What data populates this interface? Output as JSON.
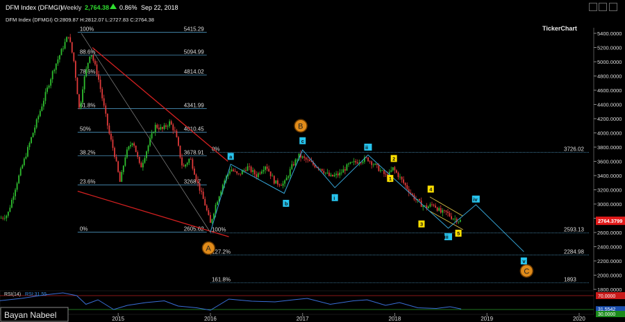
{
  "header": {
    "title": "DFM Index (DFMGI)",
    "interval": "Weekly",
    "last_price": "2,764.38",
    "up_arrow": "up-triangle",
    "change_pct": "0.86%",
    "date": "Sep 22, 2018",
    "ohlc_line": "DFM Index (DFMGI)   O:2809.87  H:2812.07  L:2727.83  C:2764.38"
  },
  "brand": {
    "logo": "TickerChart"
  },
  "watermark": "Bayan Nabeel",
  "colors": {
    "background": "#000000",
    "up_candle": "#2fbf2f",
    "down_candle": "#e03a3a",
    "fib_line": "#4a90b8",
    "trend_line": "#d42020",
    "wave_line": "#36a6d8",
    "label_yellow": "#ffe000",
    "label_cyan": "#27c4ee",
    "label_orange": "#e08b1a",
    "price_box": "#e21a1a"
  },
  "chart_data": {
    "type": "line",
    "price_axis": {
      "ticks": [
        {
          "v": 5400,
          "label": "5400.0000"
        },
        {
          "v": 5200,
          "label": "5200.0000"
        },
        {
          "v": 5000,
          "label": "5000.0000"
        },
        {
          "v": 4800,
          "label": "4800.0000"
        },
        {
          "v": 4600,
          "label": "4600.0000"
        },
        {
          "v": 4400,
          "label": "4400.0000"
        },
        {
          "v": 4200,
          "label": "4200.0000"
        },
        {
          "v": 4000,
          "label": "4000.0000"
        },
        {
          "v": 3800,
          "label": "3800.0000"
        },
        {
          "v": 3600,
          "label": "3600.0000"
        },
        {
          "v": 3400,
          "label": "3400.0000"
        },
        {
          "v": 3200,
          "label": "3200.0000"
        },
        {
          "v": 3000,
          "label": "3000.0000"
        },
        {
          "v": 2800,
          "label": "2800.0000"
        },
        {
          "v": 2600,
          "label": "2600.0000"
        },
        {
          "v": 2400,
          "label": "2400.0000"
        },
        {
          "v": 2200,
          "label": "2200.0000"
        },
        {
          "v": 2000,
          "label": "2000.0000"
        },
        {
          "v": 1800,
          "label": "1800.0000"
        }
      ],
      "last_price_label": "2764.3799",
      "last_price": 2764.38
    },
    "time_axis": {
      "ticks": [
        {
          "t": 2015.0,
          "label": "2015"
        },
        {
          "t": 2016.0,
          "label": "2016"
        },
        {
          "t": 2017.0,
          "label": "2017"
        },
        {
          "t": 2018.0,
          "label": "2018"
        },
        {
          "t": 2019.0,
          "label": "2019"
        },
        {
          "t": 2020.0,
          "label": "2020"
        }
      ]
    },
    "fib_retracement": {
      "from": 2014.56,
      "to": 2017.0,
      "levels": [
        {
          "pct": "100%",
          "price": 5415.29,
          "value": "5415.29"
        },
        {
          "pct": "88.6%",
          "price": 5094.99,
          "value": "5094.99"
        },
        {
          "pct": "78.6%",
          "price": 4814.02,
          "value": "4814.02"
        },
        {
          "pct": "61.8%",
          "price": 4341.99,
          "value": "4341.99"
        },
        {
          "pct": "50%",
          "price": 4010.45,
          "value": "4010.45"
        },
        {
          "pct": "38.2%",
          "price": 3678.91,
          "value": "3678.91"
        },
        {
          "pct": "23.6%",
          "price": 3268.7,
          "value": "3268.7"
        },
        {
          "pct": "0%",
          "price": 2605.62,
          "value": "2605.62"
        }
      ]
    },
    "fib_extension": {
      "from": 2016.0,
      "to": 2020.0,
      "levels": [
        {
          "pct": "0%",
          "price": 3726.02,
          "value": "3726.02"
        },
        {
          "pct": "100%",
          "price": 2593.13,
          "value": "2593.13"
        },
        {
          "pct": "127.2%",
          "price": 2284.98,
          "value": "2284.98"
        },
        {
          "pct": "161.8%",
          "price": 1893,
          "value": "1893"
        }
      ]
    },
    "trend_lines": [
      {
        "t1": 2014.72,
        "p1": 5200,
        "t2": 2016.19,
        "p2": 3600
      },
      {
        "t1": 2014.56,
        "p1": 3180,
        "t2": 2016.2,
        "p2": 2540
      },
      {
        "t1": 2014.6,
        "p1": 5400,
        "t2": 2016.0,
        "p2": 2600
      }
    ],
    "channel_lines": [
      {
        "t1": 2018.38,
        "p1": 3100,
        "t2": 2018.74,
        "p2": 2830
      },
      {
        "t1": 2018.38,
        "p1": 2900,
        "t2": 2018.74,
        "p2": 2640
      }
    ],
    "wave_path": [
      {
        "t": 2016.0,
        "p": 2605
      },
      {
        "t": 2016.22,
        "p": 3560
      },
      {
        "t": 2016.8,
        "p": 3150
      },
      {
        "t": 2017.0,
        "p": 3760
      },
      {
        "t": 2017.35,
        "p": 3230
      },
      {
        "t": 2017.71,
        "p": 3690
      },
      {
        "t": 2018.58,
        "p": 2660
      },
      {
        "t": 2018.88,
        "p": 2990
      },
      {
        "t": 2019.4,
        "p": 2330
      }
    ],
    "wave_labels": [
      {
        "text": "A",
        "t": 2015.98,
        "p": 2380,
        "style": "orange"
      },
      {
        "text": "B",
        "t": 2016.98,
        "p": 4100,
        "style": "orange"
      },
      {
        "text": "C",
        "t": 2019.43,
        "p": 2060,
        "style": "orange"
      },
      {
        "text": "a",
        "t": 2016.22,
        "p": 3670,
        "style": "cyan"
      },
      {
        "text": "b",
        "t": 2016.82,
        "p": 3010,
        "style": "cyan"
      },
      {
        "text": "c",
        "t": 2017.0,
        "p": 3890,
        "style": "cyan"
      },
      {
        "text": "i",
        "t": 2017.35,
        "p": 3090,
        "style": "cyan"
      },
      {
        "text": "ii",
        "t": 2017.71,
        "p": 3800,
        "style": "cyan"
      },
      {
        "text": "iii",
        "t": 2018.58,
        "p": 2540,
        "style": "cyan"
      },
      {
        "text": "iv",
        "t": 2018.88,
        "p": 3070,
        "style": "cyan"
      },
      {
        "text": "v",
        "t": 2019.4,
        "p": 2200,
        "style": "cyan"
      },
      {
        "text": "1",
        "t": 2017.95,
        "p": 3360,
        "style": "yellow"
      },
      {
        "text": "2",
        "t": 2017.99,
        "p": 3640,
        "style": "yellow"
      },
      {
        "text": "3",
        "t": 2018.29,
        "p": 2720,
        "style": "yellow"
      },
      {
        "text": "4",
        "t": 2018.39,
        "p": 3210,
        "style": "yellow"
      },
      {
        "text": "5",
        "t": 2018.69,
        "p": 2590,
        "style": "yellow"
      }
    ],
    "rsi": {
      "label": "RSI(14)",
      "value_text": "RSI:31.55",
      "overbought": "70.0000",
      "current": "31.5542",
      "oversold": "30.0000",
      "series": [
        {
          "t": 2013.7,
          "v": 55
        },
        {
          "t": 2013.95,
          "v": 62
        },
        {
          "t": 2014.2,
          "v": 72
        },
        {
          "t": 2014.4,
          "v": 78
        },
        {
          "t": 2014.55,
          "v": 70
        },
        {
          "t": 2014.65,
          "v": 45
        },
        {
          "t": 2014.78,
          "v": 58
        },
        {
          "t": 2014.95,
          "v": 30
        },
        {
          "t": 2015.1,
          "v": 42
        },
        {
          "t": 2015.3,
          "v": 50
        },
        {
          "t": 2015.5,
          "v": 55
        },
        {
          "t": 2015.65,
          "v": 40
        },
        {
          "t": 2015.85,
          "v": 35
        },
        {
          "t": 2016.0,
          "v": 28
        },
        {
          "t": 2016.2,
          "v": 60
        },
        {
          "t": 2016.45,
          "v": 54
        },
        {
          "t": 2016.7,
          "v": 52
        },
        {
          "t": 2016.9,
          "v": 58
        },
        {
          "t": 2017.05,
          "v": 62
        },
        {
          "t": 2017.3,
          "v": 45
        },
        {
          "t": 2017.55,
          "v": 55
        },
        {
          "t": 2017.7,
          "v": 58
        },
        {
          "t": 2017.9,
          "v": 42
        },
        {
          "t": 2018.05,
          "v": 50
        },
        {
          "t": 2018.25,
          "v": 35
        },
        {
          "t": 2018.45,
          "v": 33
        },
        {
          "t": 2018.6,
          "v": 38
        },
        {
          "t": 2018.72,
          "v": 31.55
        }
      ]
    }
  }
}
